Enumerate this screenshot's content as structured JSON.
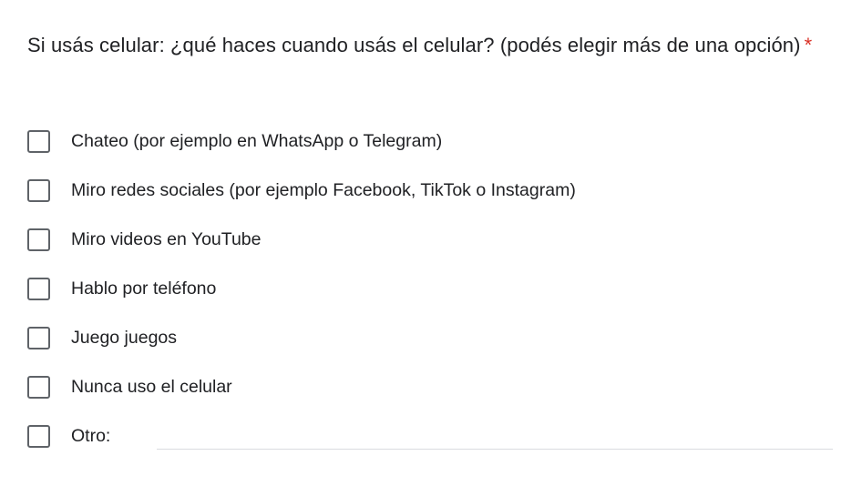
{
  "question": {
    "title": "Si usás celular: ¿qué haces cuando usás el celular? (podés elegir más de una opción)",
    "required_mark": "*"
  },
  "options": [
    {
      "label": "Chateo (por ejemplo en WhatsApp o Telegram)",
      "checked": false
    },
    {
      "label": "Miro redes sociales (por ejemplo Facebook, TikTok o Instagram)",
      "checked": false
    },
    {
      "label": "Miro videos en YouTube",
      "checked": false
    },
    {
      "label": "Hablo por teléfono",
      "checked": false
    },
    {
      "label": "Juego juegos",
      "checked": false
    },
    {
      "label": "Nunca uso el celular",
      "checked": false
    },
    {
      "label": "Otro:",
      "checked": false
    }
  ],
  "other": {
    "value": ""
  },
  "colors": {
    "text": "#202124",
    "required": "#d93025",
    "checkbox_border": "#5f6368",
    "input_underline": "#dadce0"
  }
}
